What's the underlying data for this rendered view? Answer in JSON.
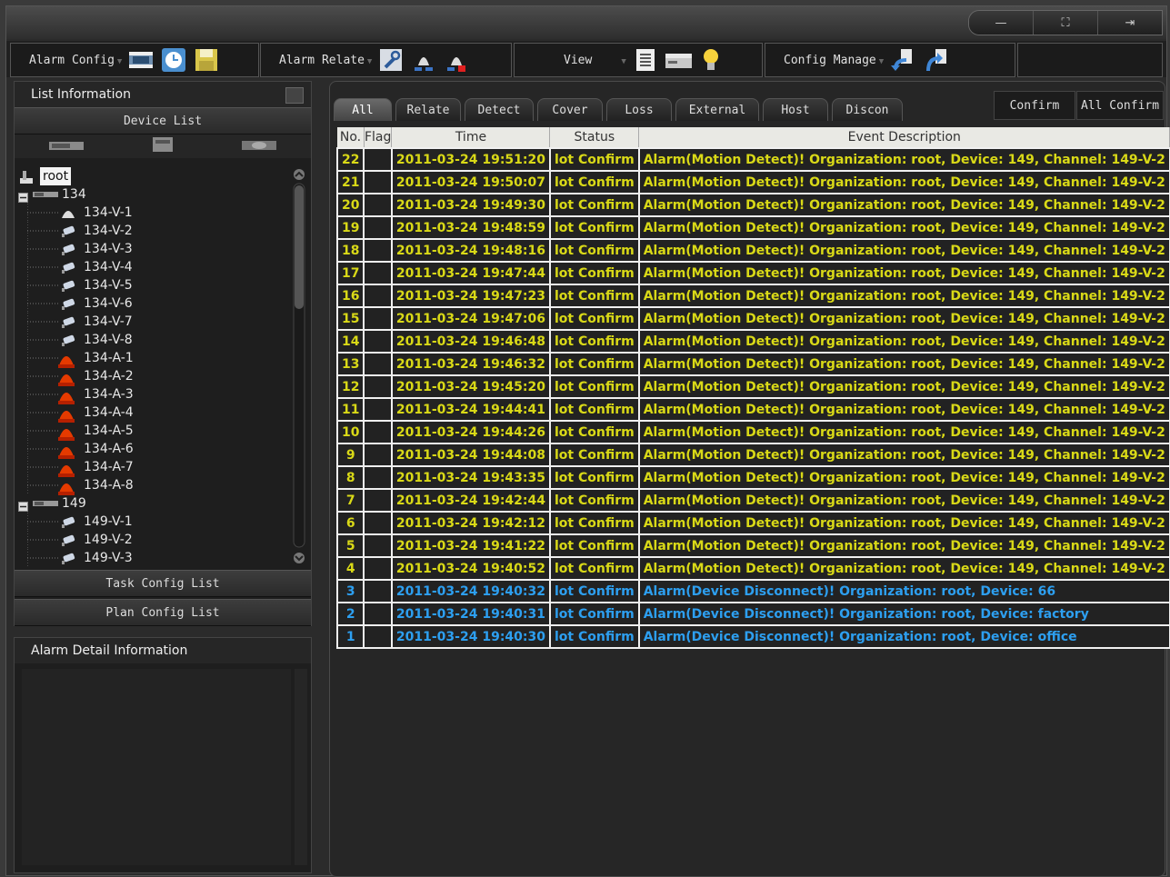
{
  "window": {
    "controls": [
      {
        "name": "minimize",
        "glyph": "—"
      },
      {
        "name": "fullscreen",
        "glyph": "⛶"
      },
      {
        "name": "exit",
        "glyph": "⇥"
      }
    ]
  },
  "toolbar": {
    "alarm_config": "Alarm Config",
    "alarm_relate": "Alarm Relate",
    "view": "View",
    "config_manage": "Config Manage"
  },
  "list_info": {
    "title": "List Information",
    "device_list": "Device List",
    "task_config_list": "Task Config List",
    "plan_config_list": "Plan Config List",
    "tree": [
      {
        "label": "root",
        "level": 0,
        "icon": "org-icon"
      },
      {
        "label": "134",
        "level": 1,
        "icon": "device-icon"
      },
      {
        "label": "134-V-1",
        "level": 2,
        "icon": "camera-dome-icon"
      },
      {
        "label": "134-V-2",
        "level": 2,
        "icon": "camera-icon"
      },
      {
        "label": "134-V-3",
        "level": 2,
        "icon": "camera-icon"
      },
      {
        "label": "134-V-4",
        "level": 2,
        "icon": "camera-icon"
      },
      {
        "label": "134-V-5",
        "level": 2,
        "icon": "camera-icon"
      },
      {
        "label": "134-V-6",
        "level": 2,
        "icon": "camera-icon"
      },
      {
        "label": "134-V-7",
        "level": 2,
        "icon": "camera-icon"
      },
      {
        "label": "134-V-8",
        "level": 2,
        "icon": "camera-icon"
      },
      {
        "label": "134-A-1",
        "level": 2,
        "icon": "alarm-light-icon"
      },
      {
        "label": "134-A-2",
        "level": 2,
        "icon": "alarm-light-icon"
      },
      {
        "label": "134-A-3",
        "level": 2,
        "icon": "alarm-light-icon"
      },
      {
        "label": "134-A-4",
        "level": 2,
        "icon": "alarm-light-icon"
      },
      {
        "label": "134-A-5",
        "level": 2,
        "icon": "alarm-light-icon"
      },
      {
        "label": "134-A-6",
        "level": 2,
        "icon": "alarm-light-icon"
      },
      {
        "label": "134-A-7",
        "level": 2,
        "icon": "alarm-light-icon"
      },
      {
        "label": "134-A-8",
        "level": 2,
        "icon": "alarm-light-icon"
      },
      {
        "label": "149",
        "level": 1,
        "icon": "device-icon"
      },
      {
        "label": "149-V-1",
        "level": 2,
        "icon": "camera-icon"
      },
      {
        "label": "149-V-2",
        "level": 2,
        "icon": "camera-icon"
      },
      {
        "label": "149-V-3",
        "level": 2,
        "icon": "camera-icon"
      }
    ]
  },
  "alarm_detail": {
    "title": "Alarm Detail Information"
  },
  "events": {
    "tabs": [
      "All",
      "Relate",
      "Detect",
      "Cover",
      "Loss",
      "External",
      "Host",
      "Discon"
    ],
    "active_tab": "All",
    "confirm": "Confirm",
    "all_confirm": "All Confirm",
    "columns": [
      "No.",
      "Flag",
      "Time",
      "Status",
      "Event Description"
    ],
    "colors": {
      "motion": "#d9d917",
      "disconnect": "#2d9ff0",
      "header_bg": "#e9e9e4"
    },
    "rows": [
      {
        "no": "22",
        "flag": "",
        "time": "2011-03-24 19:51:20",
        "status": "lot Confirm",
        "desc": "Alarm(Motion Detect)! Organization: root, Device: 149, Channel: 149-V-2",
        "kind": "motion"
      },
      {
        "no": "21",
        "flag": "",
        "time": "2011-03-24 19:50:07",
        "status": "lot Confirm",
        "desc": "Alarm(Motion Detect)! Organization: root, Device: 149, Channel: 149-V-2",
        "kind": "motion"
      },
      {
        "no": "20",
        "flag": "",
        "time": "2011-03-24 19:49:30",
        "status": "lot Confirm",
        "desc": "Alarm(Motion Detect)! Organization: root, Device: 149, Channel: 149-V-2",
        "kind": "motion"
      },
      {
        "no": "19",
        "flag": "",
        "time": "2011-03-24 19:48:59",
        "status": "lot Confirm",
        "desc": "Alarm(Motion Detect)! Organization: root, Device: 149, Channel: 149-V-2",
        "kind": "motion"
      },
      {
        "no": "18",
        "flag": "",
        "time": "2011-03-24 19:48:16",
        "status": "lot Confirm",
        "desc": "Alarm(Motion Detect)! Organization: root, Device: 149, Channel: 149-V-2",
        "kind": "motion"
      },
      {
        "no": "17",
        "flag": "",
        "time": "2011-03-24 19:47:44",
        "status": "lot Confirm",
        "desc": "Alarm(Motion Detect)! Organization: root, Device: 149, Channel: 149-V-2",
        "kind": "motion"
      },
      {
        "no": "16",
        "flag": "",
        "time": "2011-03-24 19:47:23",
        "status": "lot Confirm",
        "desc": "Alarm(Motion Detect)! Organization: root, Device: 149, Channel: 149-V-2",
        "kind": "motion"
      },
      {
        "no": "15",
        "flag": "",
        "time": "2011-03-24 19:47:06",
        "status": "lot Confirm",
        "desc": "Alarm(Motion Detect)! Organization: root, Device: 149, Channel: 149-V-2",
        "kind": "motion"
      },
      {
        "no": "14",
        "flag": "",
        "time": "2011-03-24 19:46:48",
        "status": "lot Confirm",
        "desc": "Alarm(Motion Detect)! Organization: root, Device: 149, Channel: 149-V-2",
        "kind": "motion"
      },
      {
        "no": "13",
        "flag": "",
        "time": "2011-03-24 19:46:32",
        "status": "lot Confirm",
        "desc": "Alarm(Motion Detect)! Organization: root, Device: 149, Channel: 149-V-2",
        "kind": "motion"
      },
      {
        "no": "12",
        "flag": "",
        "time": "2011-03-24 19:45:20",
        "status": "lot Confirm",
        "desc": "Alarm(Motion Detect)! Organization: root, Device: 149, Channel: 149-V-2",
        "kind": "motion"
      },
      {
        "no": "11",
        "flag": "",
        "time": "2011-03-24 19:44:41",
        "status": "lot Confirm",
        "desc": "Alarm(Motion Detect)! Organization: root, Device: 149, Channel: 149-V-2",
        "kind": "motion"
      },
      {
        "no": "10",
        "flag": "",
        "time": "2011-03-24 19:44:26",
        "status": "lot Confirm",
        "desc": "Alarm(Motion Detect)! Organization: root, Device: 149, Channel: 149-V-2",
        "kind": "motion"
      },
      {
        "no": "9",
        "flag": "",
        "time": "2011-03-24 19:44:08",
        "status": "lot Confirm",
        "desc": "Alarm(Motion Detect)! Organization: root, Device: 149, Channel: 149-V-2",
        "kind": "motion"
      },
      {
        "no": "8",
        "flag": "",
        "time": "2011-03-24 19:43:35",
        "status": "lot Confirm",
        "desc": "Alarm(Motion Detect)! Organization: root, Device: 149, Channel: 149-V-2",
        "kind": "motion"
      },
      {
        "no": "7",
        "flag": "",
        "time": "2011-03-24 19:42:44",
        "status": "lot Confirm",
        "desc": "Alarm(Motion Detect)! Organization: root, Device: 149, Channel: 149-V-2",
        "kind": "motion"
      },
      {
        "no": "6",
        "flag": "",
        "time": "2011-03-24 19:42:12",
        "status": "lot Confirm",
        "desc": "Alarm(Motion Detect)! Organization: root, Device: 149, Channel: 149-V-2",
        "kind": "motion"
      },
      {
        "no": "5",
        "flag": "",
        "time": "2011-03-24 19:41:22",
        "status": "lot Confirm",
        "desc": "Alarm(Motion Detect)! Organization: root, Device: 149, Channel: 149-V-2",
        "kind": "motion"
      },
      {
        "no": "4",
        "flag": "",
        "time": "2011-03-24 19:40:52",
        "status": "lot Confirm",
        "desc": "Alarm(Motion Detect)! Organization: root, Device: 149, Channel: 149-V-2",
        "kind": "motion"
      },
      {
        "no": "3",
        "flag": "",
        "time": "2011-03-24 19:40:32",
        "status": "lot Confirm",
        "desc": "Alarm(Device Disconnect)! Organization: root, Device: 66",
        "kind": "disc"
      },
      {
        "no": "2",
        "flag": "",
        "time": "2011-03-24 19:40:31",
        "status": "lot Confirm",
        "desc": "Alarm(Device Disconnect)! Organization: root, Device: factory",
        "kind": "disc"
      },
      {
        "no": "1",
        "flag": "",
        "time": "2011-03-24 19:40:30",
        "status": "lot Confirm",
        "desc": "Alarm(Device Disconnect)! Organization: root, Device: office",
        "kind": "disc"
      }
    ]
  }
}
